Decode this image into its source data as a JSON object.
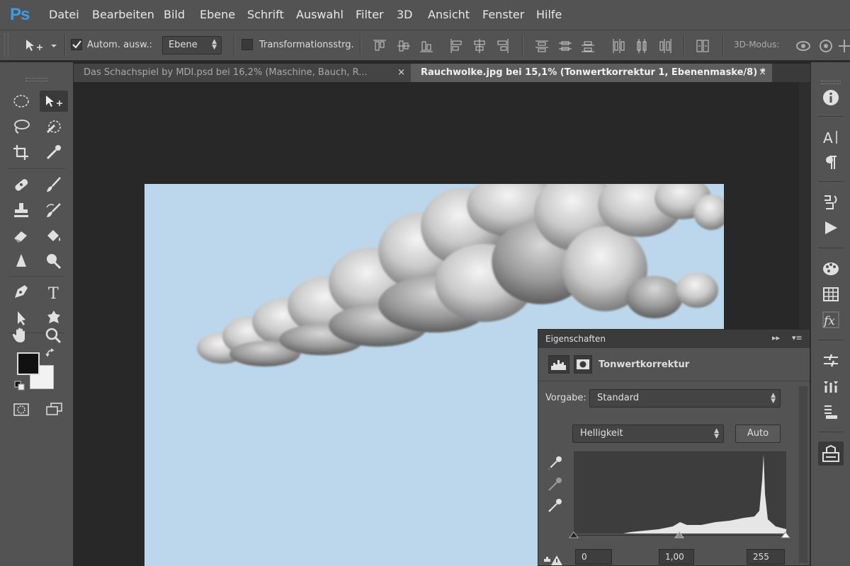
{
  "app": {
    "logo": "Ps"
  },
  "menu": [
    "Datei",
    "Bearbeiten",
    "Bild",
    "Ebene",
    "Schrift",
    "Auswahl",
    "Filter",
    "3D",
    "Ansicht",
    "Fenster",
    "Hilfe"
  ],
  "options": {
    "auto_select_label": "Autom. ausw.:",
    "auto_select_checked": true,
    "auto_select_target": "Ebene",
    "transform_label": "Transformationsstrg.",
    "transform_checked": false,
    "mode3d_label": "3D-Modus:"
  },
  "tabs": [
    {
      "label": "Das Schachspiel by MDI.psd bei 16,2% (Maschine, Bauch, R...",
      "close": "×",
      "active": false
    },
    {
      "label": "Rauchwolke.jpg bei 15,1% (Tonwertkorrektur 1, Ebenenmaske/8) *",
      "close": "×",
      "active": true
    }
  ],
  "colors": {
    "foreground": "#111111",
    "background": "#f2f2f2",
    "sky": "#bcd7ec",
    "accent": "#3d9be9"
  },
  "tools": [
    "marquee-icon",
    "move-icon",
    "lasso-icon",
    "quick-selection-icon",
    "crop-icon",
    "eyedropper-icon",
    "healing-brush-icon",
    "brush-icon",
    "stamp-icon",
    "history-brush-icon",
    "eraser-icon",
    "bucket-icon",
    "blur-icon",
    "dodge-icon",
    "pen-icon",
    "type-icon",
    "path-selection-icon",
    "shape-icon",
    "hand-icon",
    "zoom-icon"
  ],
  "properties": {
    "panel_title": "Eigenschaften",
    "adjustment_title": "Tonwertkorrektur",
    "preset_label": "Vorgabe:",
    "preset_value": "Standard",
    "channel_value": "Helligkeit",
    "auto_label": "Auto",
    "input_black": "0",
    "input_gamma": "1,00",
    "input_white": "255"
  },
  "right_dock": [
    "info-icon",
    "character-icon",
    "paragraph-icon",
    "history-icon",
    "actions-icon",
    "color-icon",
    "swatches-icon",
    "styles-icon",
    "brushes-icon",
    "tool-presets-icon",
    "layer-comps-icon",
    "properties-icon"
  ]
}
